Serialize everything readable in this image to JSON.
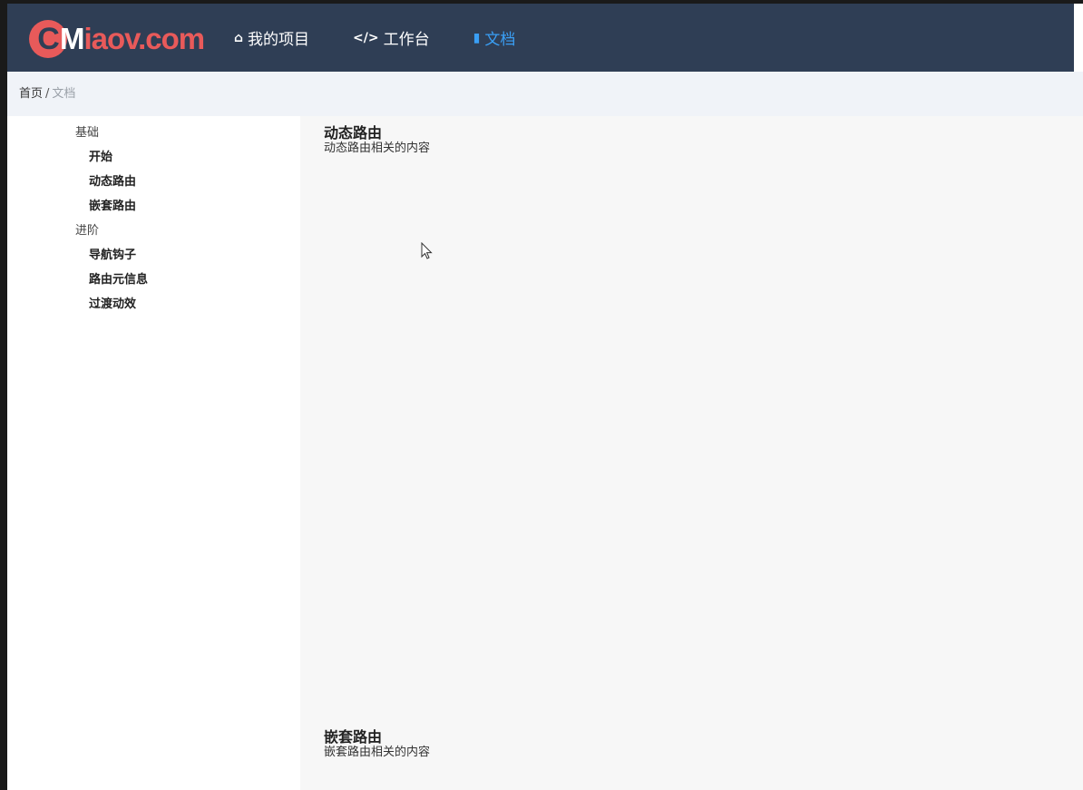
{
  "header": {
    "logo": {
      "c": "C",
      "m": "M",
      "rest": "iaov.com"
    },
    "nav": [
      {
        "label": "我的项目",
        "icon": "home-icon",
        "glyph": "⌂"
      },
      {
        "label": "工作台",
        "icon": "code-icon",
        "glyph": "</>"
      },
      {
        "label": "文档",
        "icon": "book-icon",
        "glyph": "▮"
      }
    ],
    "active_color": "#3a9ff5",
    "bg_color": "#2f3e55"
  },
  "breadcrumb": {
    "home": "首页",
    "separator": "/",
    "current": "文档"
  },
  "sidebar": {
    "groups": [
      {
        "title": "基础",
        "items": [
          "开始",
          "动态路由",
          "嵌套路由"
        ]
      },
      {
        "title": "进阶",
        "items": [
          "导航钩子",
          "路由元信息",
          "过渡动效"
        ]
      }
    ]
  },
  "content": {
    "sections": [
      {
        "title": "动态路由",
        "desc": "动态路由相关的内容"
      },
      {
        "title": "嵌套路由",
        "desc": "嵌套路由相关的内容"
      }
    ]
  }
}
